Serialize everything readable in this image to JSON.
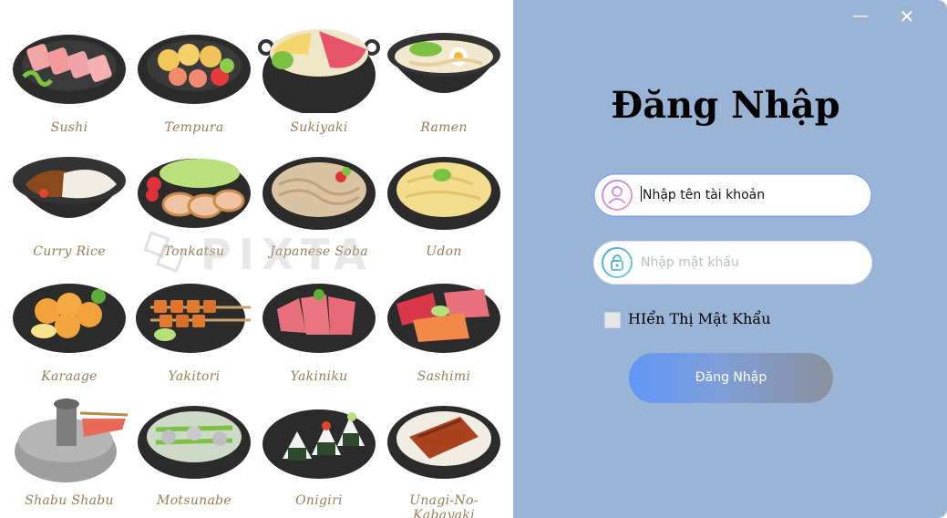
{
  "window": {
    "minimize_glyph": "—",
    "close_glyph": "✕"
  },
  "login": {
    "title": "Đăng Nhập",
    "username_value": "Nhập tên tài khoản",
    "password_placeholder": "Nhập mật khẩu",
    "show_password_label": "HIển Thị Mật Khẩu",
    "show_password_checked": false,
    "submit_label": "Đăng Nhập"
  },
  "gallery": {
    "watermark": "PIXTA",
    "dishes": [
      "Sushi",
      "Tempura",
      "Sukiyaki",
      "Ramen",
      "Curry Rice",
      "Tonkatsu",
      "Japanese Soba",
      "Udon",
      "Karaage",
      "Yakitori",
      "Yakiniku",
      "Sashimi",
      "Shabu Shabu",
      "Motsunabe",
      "Onigiri",
      "Unagi-No-Kabayaki"
    ]
  },
  "colors": {
    "panel_bg": "#99b4d4",
    "button_gradient_start": "#5f97f6",
    "button_gradient_end": "#8a8f9d",
    "label_text": "#9a7c55"
  }
}
